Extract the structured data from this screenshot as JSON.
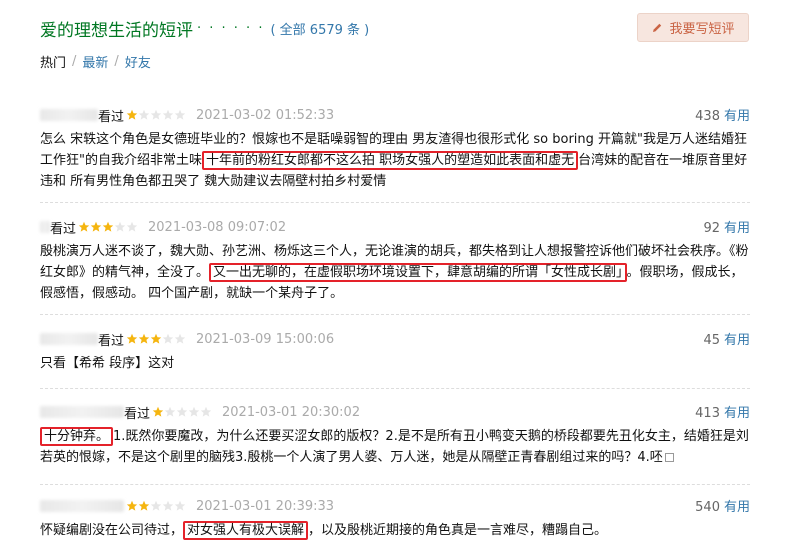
{
  "header": {
    "title": "爱的理想生活的短评",
    "dots": "· · · · · ·",
    "count_text": "( 全部 6579 条 )",
    "write_label": "我要写短评"
  },
  "sort": {
    "hot": "热门",
    "latest": "最新",
    "friends": "好友",
    "sep": "/"
  },
  "reviews": [
    {
      "seen": "看过",
      "rating": 1,
      "time": "2021-03-02 01:52:33",
      "votes": "438",
      "use": "有用",
      "text_a": "怎么 宋轶这个角色是女德班毕业的？恨嫁也不是聒噪弱智的理由 男友渣得也很形式化 so boring 开篇就\"我是万人迷结婚狂工作狂\"的自我介绍非常土味",
      "text_hl": "十年前的粉红女郎都不这么拍 职场女强人的塑造如此表面和虚无",
      "text_b": "台湾妹的配音在一堆原音里好违和 所有男性角色都丑哭了 魏大勋建议去隔壁村拍乡村爱情"
    },
    {
      "seen": "看过",
      "rating": 3,
      "time": "2021-03-08 09:07:02",
      "votes": "92",
      "use": "有用",
      "text_a": "殷桃演万人迷不谈了，魏大勋、孙艺洲、杨烁这三个人，无论谁演的胡兵，都失格到让人想报警控诉他们破坏社会秩序。《粉红女郎》的精气神，全没了。",
      "text_hl": "又一出无聊的，在虚假职场环境设置下，肆意胡编的所谓「女性成长剧」",
      "text_b": "。假职场，假成长，假感悟，假感动。 四个国产剧，就缺一个某舟子了。"
    },
    {
      "seen": "看过",
      "rating": 3,
      "time": "2021-03-09 15:00:06",
      "votes": "45",
      "use": "有用",
      "text_a": "只看【希希 段序】这对",
      "text_hl": "",
      "text_b": ""
    },
    {
      "seen": "看过",
      "rating": 1,
      "time": "2021-03-01 20:30:02",
      "votes": "413",
      "use": "有用",
      "text_a": "",
      "text_hl": "十分钟弃。",
      "text_b": "1.既然你要魔改，为什么还要买涩女郎的版权？2.是不是所有丑小鸭变天鹅的桥段都要先丑化女主，结婚狂是刘若英的恨嫁，不是这个剧里的脑残3.殷桃一个人演了男人婆、万人迷，她是从隔壁正青春剧组过来的吗？4.呸"
    },
    {
      "seen": "看过",
      "rating": 2,
      "time": "2021-03-01 20:39:33",
      "votes": "540",
      "use": "有用",
      "text_a": "怀疑编剧没在公司待过，",
      "text_hl": "对女强人有极大误解",
      "text_b": "，以及殷桃近期接的角色真是一言难尽，糟蹋自己。"
    }
  ],
  "colors": {
    "title_green": "#007722",
    "link_blue": "#3377aa",
    "star_gold": "#f5b50f",
    "highlight_red": "#e4222a",
    "button_bg": "#f7e6df",
    "button_text": "#ca6445"
  }
}
